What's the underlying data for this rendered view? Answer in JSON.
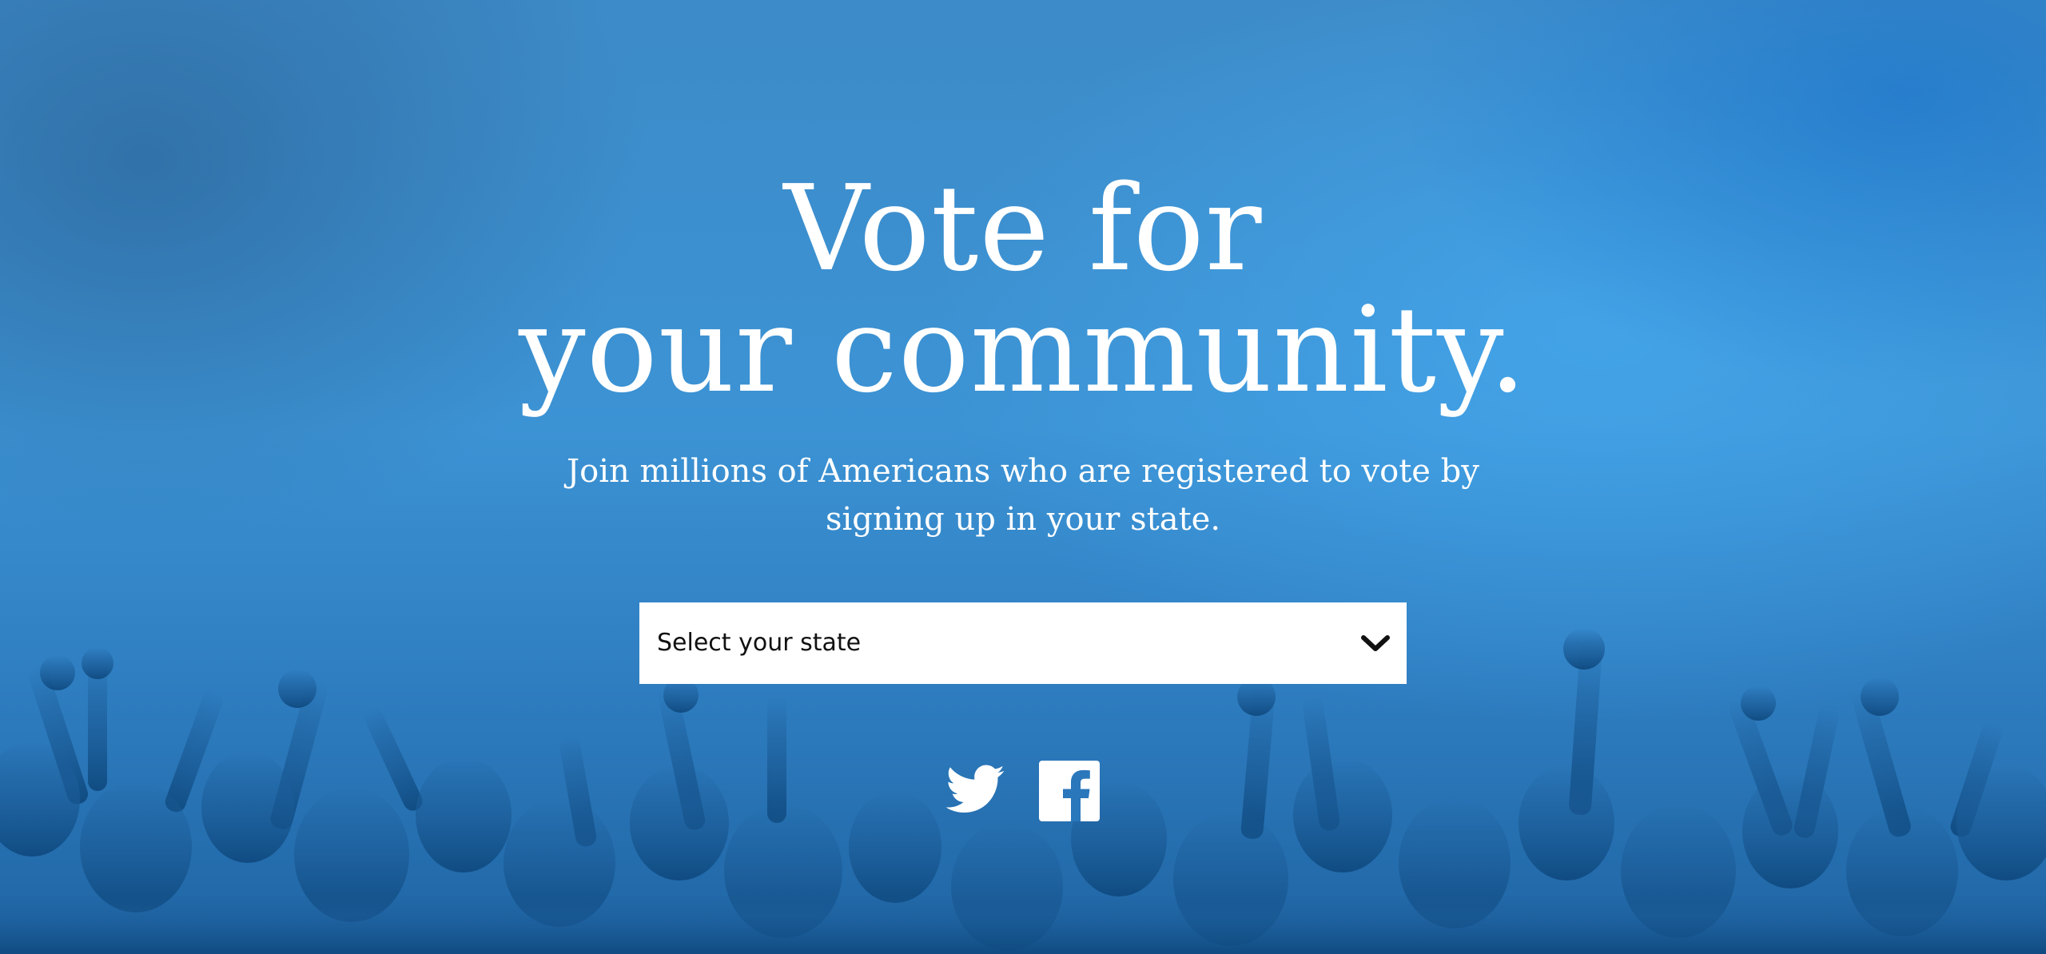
{
  "hero": {
    "title_line1": "Vote for",
    "title_line2": "your community.",
    "subtitle_line1": "Join millions of Americans who are registered to vote by",
    "subtitle_line2": "signing up in your state."
  },
  "state_select": {
    "placeholder": "Select your state",
    "icon": "chevron-down-icon"
  },
  "social": {
    "icons": [
      "twitter-icon",
      "facebook-icon"
    ]
  },
  "colors": {
    "background": "#3a8fd0",
    "text": "#ffffff",
    "select_bg": "#ffffff",
    "select_text": "#111111"
  }
}
